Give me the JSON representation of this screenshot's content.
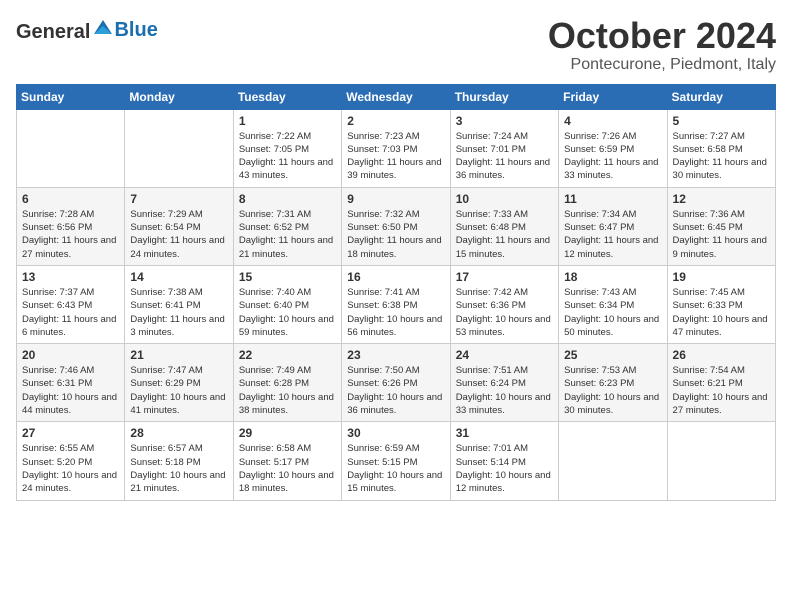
{
  "header": {
    "logo_general": "General",
    "logo_blue": "Blue",
    "month_year": "October 2024",
    "location": "Pontecurone, Piedmont, Italy"
  },
  "weekdays": [
    "Sunday",
    "Monday",
    "Tuesday",
    "Wednesday",
    "Thursday",
    "Friday",
    "Saturday"
  ],
  "weeks": [
    [
      {
        "day": "",
        "info": ""
      },
      {
        "day": "",
        "info": ""
      },
      {
        "day": "1",
        "info": "Sunrise: 7:22 AM\nSunset: 7:05 PM\nDaylight: 11 hours and 43 minutes."
      },
      {
        "day": "2",
        "info": "Sunrise: 7:23 AM\nSunset: 7:03 PM\nDaylight: 11 hours and 39 minutes."
      },
      {
        "day": "3",
        "info": "Sunrise: 7:24 AM\nSunset: 7:01 PM\nDaylight: 11 hours and 36 minutes."
      },
      {
        "day": "4",
        "info": "Sunrise: 7:26 AM\nSunset: 6:59 PM\nDaylight: 11 hours and 33 minutes."
      },
      {
        "day": "5",
        "info": "Sunrise: 7:27 AM\nSunset: 6:58 PM\nDaylight: 11 hours and 30 minutes."
      }
    ],
    [
      {
        "day": "6",
        "info": "Sunrise: 7:28 AM\nSunset: 6:56 PM\nDaylight: 11 hours and 27 minutes."
      },
      {
        "day": "7",
        "info": "Sunrise: 7:29 AM\nSunset: 6:54 PM\nDaylight: 11 hours and 24 minutes."
      },
      {
        "day": "8",
        "info": "Sunrise: 7:31 AM\nSunset: 6:52 PM\nDaylight: 11 hours and 21 minutes."
      },
      {
        "day": "9",
        "info": "Sunrise: 7:32 AM\nSunset: 6:50 PM\nDaylight: 11 hours and 18 minutes."
      },
      {
        "day": "10",
        "info": "Sunrise: 7:33 AM\nSunset: 6:48 PM\nDaylight: 11 hours and 15 minutes."
      },
      {
        "day": "11",
        "info": "Sunrise: 7:34 AM\nSunset: 6:47 PM\nDaylight: 11 hours and 12 minutes."
      },
      {
        "day": "12",
        "info": "Sunrise: 7:36 AM\nSunset: 6:45 PM\nDaylight: 11 hours and 9 minutes."
      }
    ],
    [
      {
        "day": "13",
        "info": "Sunrise: 7:37 AM\nSunset: 6:43 PM\nDaylight: 11 hours and 6 minutes."
      },
      {
        "day": "14",
        "info": "Sunrise: 7:38 AM\nSunset: 6:41 PM\nDaylight: 11 hours and 3 minutes."
      },
      {
        "day": "15",
        "info": "Sunrise: 7:40 AM\nSunset: 6:40 PM\nDaylight: 10 hours and 59 minutes."
      },
      {
        "day": "16",
        "info": "Sunrise: 7:41 AM\nSunset: 6:38 PM\nDaylight: 10 hours and 56 minutes."
      },
      {
        "day": "17",
        "info": "Sunrise: 7:42 AM\nSunset: 6:36 PM\nDaylight: 10 hours and 53 minutes."
      },
      {
        "day": "18",
        "info": "Sunrise: 7:43 AM\nSunset: 6:34 PM\nDaylight: 10 hours and 50 minutes."
      },
      {
        "day": "19",
        "info": "Sunrise: 7:45 AM\nSunset: 6:33 PM\nDaylight: 10 hours and 47 minutes."
      }
    ],
    [
      {
        "day": "20",
        "info": "Sunrise: 7:46 AM\nSunset: 6:31 PM\nDaylight: 10 hours and 44 minutes."
      },
      {
        "day": "21",
        "info": "Sunrise: 7:47 AM\nSunset: 6:29 PM\nDaylight: 10 hours and 41 minutes."
      },
      {
        "day": "22",
        "info": "Sunrise: 7:49 AM\nSunset: 6:28 PM\nDaylight: 10 hours and 38 minutes."
      },
      {
        "day": "23",
        "info": "Sunrise: 7:50 AM\nSunset: 6:26 PM\nDaylight: 10 hours and 36 minutes."
      },
      {
        "day": "24",
        "info": "Sunrise: 7:51 AM\nSunset: 6:24 PM\nDaylight: 10 hours and 33 minutes."
      },
      {
        "day": "25",
        "info": "Sunrise: 7:53 AM\nSunset: 6:23 PM\nDaylight: 10 hours and 30 minutes."
      },
      {
        "day": "26",
        "info": "Sunrise: 7:54 AM\nSunset: 6:21 PM\nDaylight: 10 hours and 27 minutes."
      }
    ],
    [
      {
        "day": "27",
        "info": "Sunrise: 6:55 AM\nSunset: 5:20 PM\nDaylight: 10 hours and 24 minutes."
      },
      {
        "day": "28",
        "info": "Sunrise: 6:57 AM\nSunset: 5:18 PM\nDaylight: 10 hours and 21 minutes."
      },
      {
        "day": "29",
        "info": "Sunrise: 6:58 AM\nSunset: 5:17 PM\nDaylight: 10 hours and 18 minutes."
      },
      {
        "day": "30",
        "info": "Sunrise: 6:59 AM\nSunset: 5:15 PM\nDaylight: 10 hours and 15 minutes."
      },
      {
        "day": "31",
        "info": "Sunrise: 7:01 AM\nSunset: 5:14 PM\nDaylight: 10 hours and 12 minutes."
      },
      {
        "day": "",
        "info": ""
      },
      {
        "day": "",
        "info": ""
      }
    ]
  ]
}
